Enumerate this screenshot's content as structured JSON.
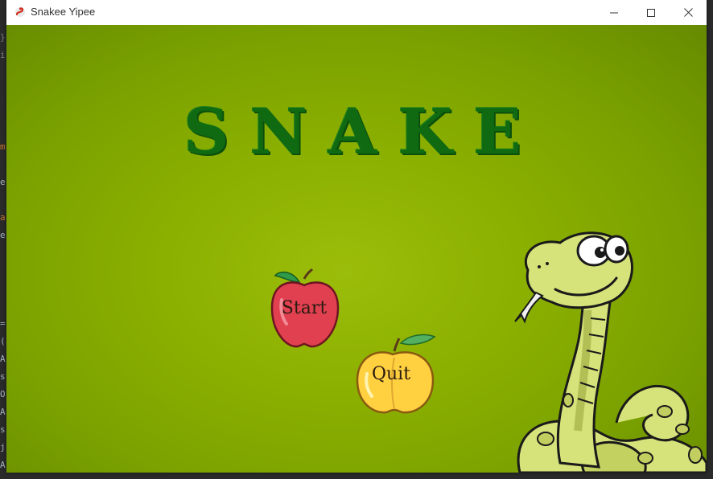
{
  "window": {
    "title": "Snakee Yipee",
    "minimize_icon": "minimize-icon",
    "maximize_icon": "maximize-icon",
    "close_icon": "close-icon"
  },
  "background_ide": {
    "fragments": [
      "}",
      "i",
      "m",
      "e",
      "a",
      "e",
      "=",
      "(",
      "A",
      "s",
      "O",
      "A",
      "s",
      "j",
      "A"
    ]
  },
  "game": {
    "title": "SNAKE",
    "start_label": "Start",
    "quit_label": "Quit",
    "colors": {
      "background": "#8cb000",
      "title": "#106a12",
      "apple_red": "#e04050",
      "apple_yellow": "#ffd040",
      "snake_body": "#d6e27a"
    }
  }
}
